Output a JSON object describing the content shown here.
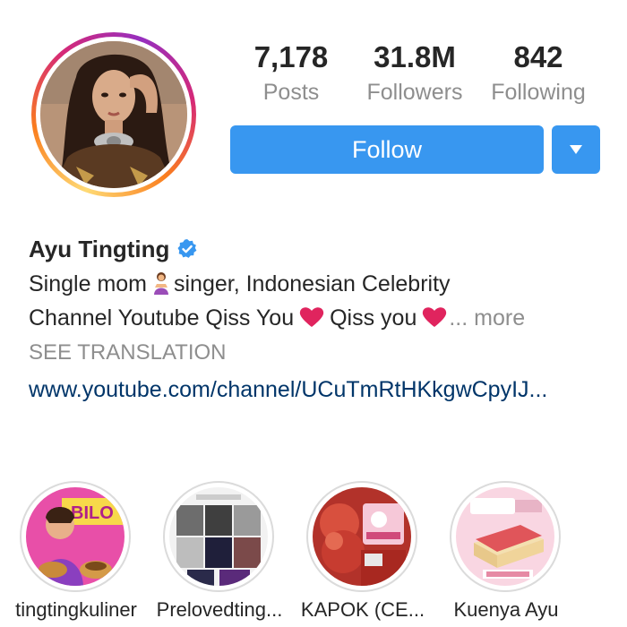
{
  "profile": {
    "name": "Ayu Tingting",
    "verified": true
  },
  "stats": {
    "posts": {
      "value": "7,178",
      "label": "Posts"
    },
    "followers": {
      "value": "31.8M",
      "label": "Followers"
    },
    "following": {
      "value": "842",
      "label": "Following"
    }
  },
  "actions": {
    "follow_label": "Follow",
    "dropdown_icon": "caret-down-icon"
  },
  "bio": {
    "line1_before": "Single mom",
    "line1_emoji": "woman-emoji",
    "line1_after": "singer, Indonesian Celebrity",
    "line2_part1": "Channel Youtube Qiss You",
    "line2_part2": "Qiss you",
    "line2_more": "... more",
    "see_translation": "SEE TRANSLATION",
    "website": "www.youtube.com/channel/UCuTmRtHKkgwCpyIJ..."
  },
  "highlights": [
    {
      "label": "tingtingkuliner"
    },
    {
      "label": "Prelovedting..."
    },
    {
      "label": "KAPOK (CE..."
    },
    {
      "label": "Kuenya Ayu"
    }
  ],
  "colors": {
    "follow_blue": "#3897f0",
    "verified_blue": "#3897f0",
    "heart_pink": "#e0245e",
    "link_color": "#003569",
    "muted_text": "#8e8e8e"
  }
}
